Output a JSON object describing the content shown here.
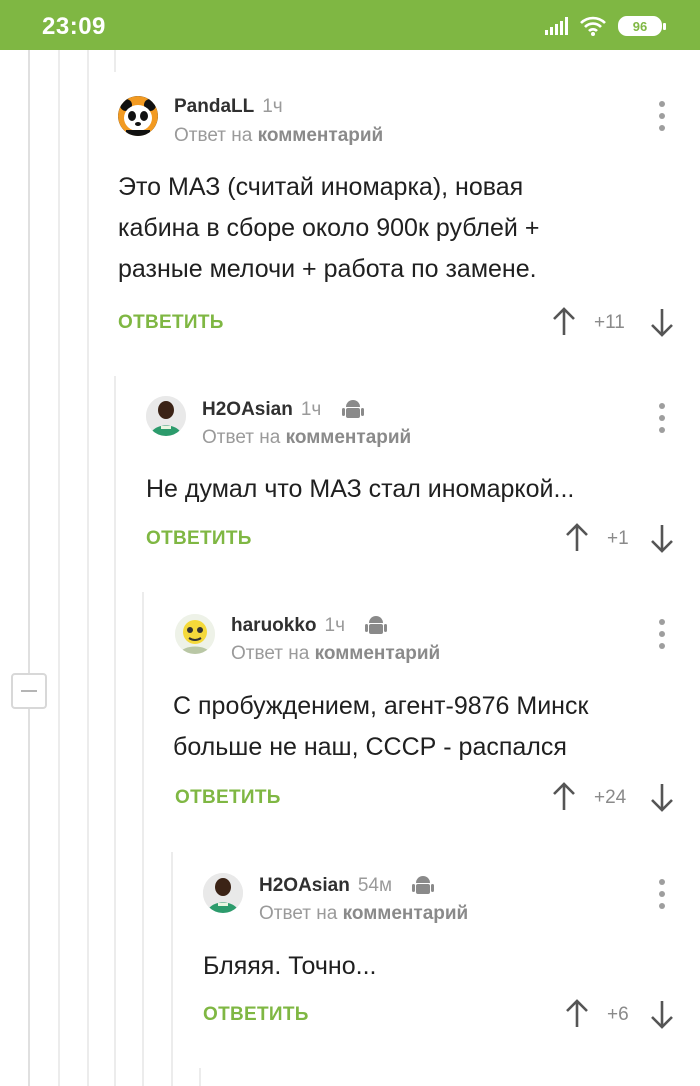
{
  "status_bar": {
    "time": "23:09",
    "battery": "96"
  },
  "icons": {
    "signal": "signal-icon",
    "wifi": "wifi-icon",
    "battery": "battery-icon",
    "android": "android-icon",
    "menu": "more-vertical-icon",
    "up": "arrow-up-icon",
    "down": "arrow-down-icon",
    "collapse": "minus-icon"
  },
  "colors": {
    "accent": "#7fb743",
    "text": "#202020",
    "muted": "#9a9a9a"
  },
  "comments": [
    {
      "username": "PandaLL",
      "time": "1ч",
      "reply_prefix": "Ответ на",
      "reply_target": "комментарий",
      "text_lines": [
        "Это МАЗ (считай иномарка), новая",
        "кабина в сборе около 900к рублей +",
        "разные мелочи + работа по замене."
      ],
      "reply_label": "ОТВЕТИТЬ",
      "rating": "+11",
      "android": false
    },
    {
      "username": "H2OAsian",
      "time": "1ч",
      "reply_prefix": "Ответ на",
      "reply_target": "комментарий",
      "text_lines": [
        "Не думал что МАЗ стал иномаркой..."
      ],
      "reply_label": "ОТВЕТИТЬ",
      "rating": "+1",
      "android": true
    },
    {
      "username": "haruokko",
      "time": "1ч",
      "reply_prefix": "Ответ на",
      "reply_target": "комментарий",
      "text_lines": [
        "С пробуждением, агент-9876 Минск",
        "больше не наш, СССР - распался"
      ],
      "reply_label": "ОТВЕТИТЬ",
      "rating": "+24",
      "android": true
    },
    {
      "username": "H2OAsian",
      "time": "54м",
      "reply_prefix": "Ответ на",
      "reply_target": "комментарий",
      "text_lines": [
        "Бляяя. Точно..."
      ],
      "reply_label": "ОТВЕТИТЬ",
      "rating": "+6",
      "android": true
    }
  ]
}
